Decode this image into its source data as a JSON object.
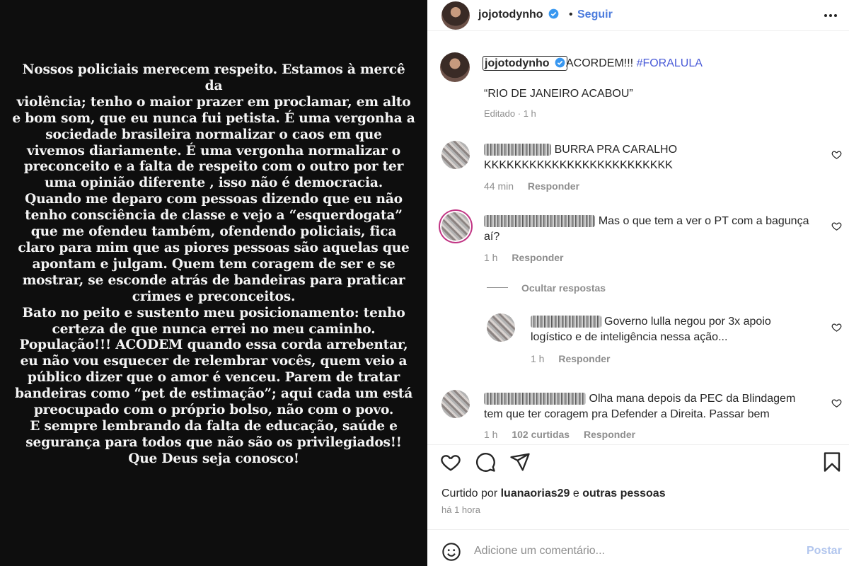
{
  "story": {
    "text": "Nossos policiais merecem respeito. Estamos à mercê da\nviolência; tenho o maior prazer em proclamar, em alto\ne bom som, que eu nunca fui petista. É uma vergonha a\nsociedade brasileira normalizar o caos em que\nvivemos diariamente. É uma vergonha normalizar o\npreconceito e a falta de respeito com o outro por ter\numa opinião diferente , isso não é democracia.\nQuando me deparo com pessoas dizendo que eu não\ntenho consciência de classe e vejo a “esquerdogata”\nque me ofendeu também, ofendendo policiais, fica\nclaro para mim que as piores pessoas são aquelas que\napontam e julgam. Quem  tem coragem de ser e se\nmostrar, se esconde atrás de bandeiras para praticar\ncrimes e preconceitos.\nBato no peito e sustento meu posicionamento: tenho\ncerteza de que nunca errei no meu caminho.\nPopulação!!! ACODEM  quando essa corda arrebentar,\neu não vou esquecer de relembrar vocês, quem veio a\npúblico dizer que o amor é venceu. Parem de tratar\nbandeiras como “pet de estimação”; aqui cada um está\npreocupado com o próprio bolso, não com o povo.\nE sempre lembrando da falta de educação, saúde e\nsegurança para todos que não são os privilegiados!!\nQue Deus seja conosco!"
  },
  "header": {
    "username": "jojotodynho",
    "follow_label": "Seguir"
  },
  "caption": {
    "username": "jojotodynho",
    "text": "ACORDEM!!! ",
    "hashtag": "#FORALULA",
    "quote": "“RIO DE JANEIRO ACABOU”",
    "edited": "Editado",
    "separator": "·",
    "time": "1 h"
  },
  "comments": [
    {
      "user": "dreamleader",
      "text": "BURRA PRA CARALHO",
      "text2": "KKKKKKKKKKKKKKKKKKKKKKKKK",
      "time": "44 min",
      "reply_label": "Responder"
    },
    {
      "user": "rodrigocambuluca19",
      "text": "Mas o que tem a ver o PT com a bagunça",
      "text2": "aí?",
      "time": "1 h",
      "reply_label": "Responder",
      "hide_replies_label": "Ocultar respostas"
    },
    {
      "user": "nelsombraga",
      "text": "Governo lulla negou por 3x apoio",
      "text2": "logístico e de inteligência nessa ação...",
      "time": "1 h",
      "reply_label": "Responder"
    },
    {
      "user": "helenamartins1408",
      "text": "Olha mana depois da PEC da Blindagem",
      "text2": "tem que ter coragem pra Defender a Direita. Passar bem",
      "time": "1 h",
      "likes": "102 curtidas",
      "reply_label": "Responder"
    }
  ],
  "actions": {
    "liked_by_prefix": "Curtido por ",
    "liked_by_user": "luanaorias29",
    "liked_by_and": " e ",
    "liked_by_others": "outras pessoas",
    "time_ago": "há 1 hora"
  },
  "comment_box": {
    "placeholder": "Adicione um comentário...",
    "post_label": "Postar"
  },
  "colors": {
    "story_bg": "#0e0e0e",
    "link_blue": "#4d7cdd",
    "hashtag": "#4a5bd8",
    "muted": "#8e8e8e",
    "post_disabled": "#b2c6ee"
  },
  "icons": [
    "verified-badge-icon",
    "more-options-icon",
    "heart-icon",
    "comment-icon",
    "share-icon",
    "bookmark-icon",
    "emoji-icon"
  ]
}
